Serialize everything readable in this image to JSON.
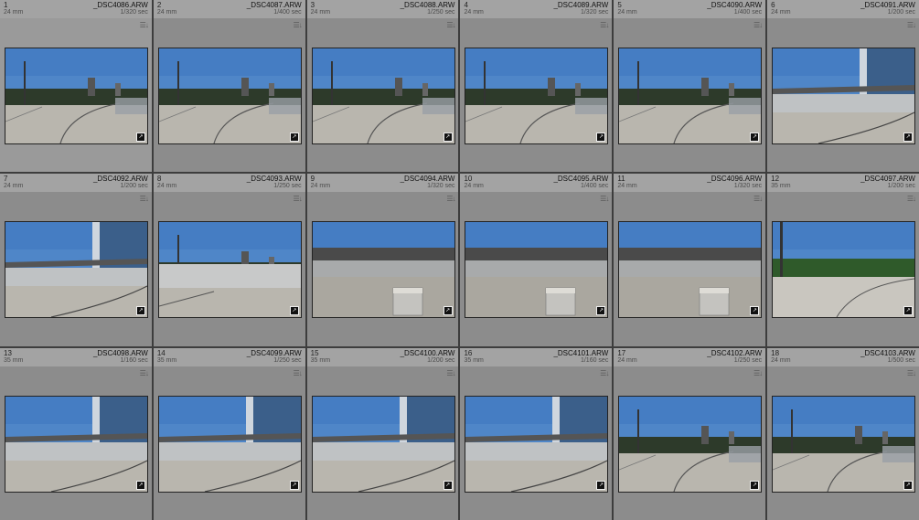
{
  "colors": {
    "sky": "#4f86c8",
    "ground": "#b9b6ae",
    "wall": "#9aa0a6",
    "building": "#3b5f8a",
    "cell": "#8c8c8c"
  },
  "icons": {
    "flag": "flag-icon",
    "edit_badge": "edit-badge-icon"
  },
  "thumbnails": [
    {
      "index": "1",
      "filename": "_DSC4086.ARW",
      "lens": "24 mm",
      "shutter": "1/320 sec",
      "scene": "plaza"
    },
    {
      "index": "2",
      "filename": "_DSC4087.ARW",
      "lens": "24 mm",
      "shutter": "1/400 sec",
      "scene": "plaza"
    },
    {
      "index": "3",
      "filename": "_DSC4088.ARW",
      "lens": "24 mm",
      "shutter": "1/250 sec",
      "scene": "plaza"
    },
    {
      "index": "4",
      "filename": "_DSC4089.ARW",
      "lens": "24 mm",
      "shutter": "1/320 sec",
      "scene": "plaza"
    },
    {
      "index": "5",
      "filename": "_DSC4090.ARW",
      "lens": "24 mm",
      "shutter": "1/400 sec",
      "scene": "plaza"
    },
    {
      "index": "6",
      "filename": "_DSC4091.ARW",
      "lens": "24 mm",
      "shutter": "1/200 sec",
      "scene": "tower"
    },
    {
      "index": "7",
      "filename": "_DSC4092.ARW",
      "lens": "24 mm",
      "shutter": "1/200 sec",
      "scene": "tower"
    },
    {
      "index": "8",
      "filename": "_DSC4093.ARW",
      "lens": "24 mm",
      "shutter": "1/250 sec",
      "scene": "wall"
    },
    {
      "index": "9",
      "filename": "_DSC4094.ARW",
      "lens": "24 mm",
      "shutter": "1/320 sec",
      "scene": "cube"
    },
    {
      "index": "10",
      "filename": "_DSC4095.ARW",
      "lens": "24 mm",
      "shutter": "1/400 sec",
      "scene": "cube"
    },
    {
      "index": "11",
      "filename": "_DSC4096.ARW",
      "lens": "24 mm",
      "shutter": "1/320 sec",
      "scene": "cube"
    },
    {
      "index": "12",
      "filename": "_DSC4097.ARW",
      "lens": "35 mm",
      "shutter": "1/200 sec",
      "scene": "park"
    },
    {
      "index": "13",
      "filename": "_DSC4098.ARW",
      "lens": "35 mm",
      "shutter": "1/160 sec",
      "scene": "tower"
    },
    {
      "index": "14",
      "filename": "_DSC4099.ARW",
      "lens": "35 mm",
      "shutter": "1/250 sec",
      "scene": "tower"
    },
    {
      "index": "15",
      "filename": "_DSC4100.ARW",
      "lens": "35 mm",
      "shutter": "1/200 sec",
      "scene": "tower"
    },
    {
      "index": "16",
      "filename": "_DSC4101.ARW",
      "lens": "35 mm",
      "shutter": "1/160 sec",
      "scene": "tower"
    },
    {
      "index": "17",
      "filename": "_DSC4102.ARW",
      "lens": "24 mm",
      "shutter": "1/250 sec",
      "scene": "plaza"
    },
    {
      "index": "18",
      "filename": "_DSC4103.ARW",
      "lens": "24 mm",
      "shutter": "1/500 sec",
      "scene": "plaza"
    }
  ]
}
